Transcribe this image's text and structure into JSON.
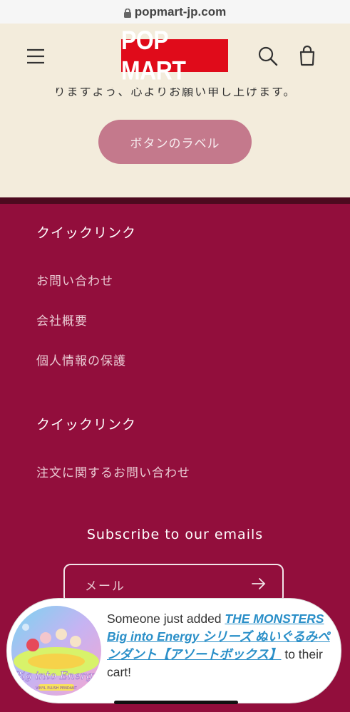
{
  "browser": {
    "url": "popmart-jp.com"
  },
  "header": {
    "logo_text": "POP MART",
    "menu_icon": "hamburger-menu-icon",
    "search_icon": "search-icon",
    "cart_icon": "cart-icon"
  },
  "banner": {
    "text": "りますよう、心よりお願い申し上げます。",
    "button_label": "ボタンのラベル"
  },
  "footer": {
    "section1": {
      "heading": "クイックリンク",
      "links": [
        "お問い合わせ",
        "会社概要",
        "個人情報の保護"
      ]
    },
    "section2": {
      "heading": "クイックリンク",
      "links": [
        "注文に関するお問い合わせ"
      ]
    },
    "subscribe": {
      "title": "Subscribe to our emails",
      "placeholder": "メール"
    }
  },
  "toast": {
    "prefix": "Someone just added ",
    "product": "THE MONSTERS Big into Energy シリーズ ぬいぐるみペンダント【アソートボックス】",
    "suffix": " to their cart!",
    "thumb_title": "Big into Energy",
    "thumb_caption": "VINYL PLUSH PENDANT"
  },
  "colors": {
    "header_bg": "#f3ecdc",
    "footer_bg": "#920e3c",
    "button_bg": "#c4798c",
    "logo_red": "#e00b1a",
    "link_blue": "#2a8fc8"
  }
}
